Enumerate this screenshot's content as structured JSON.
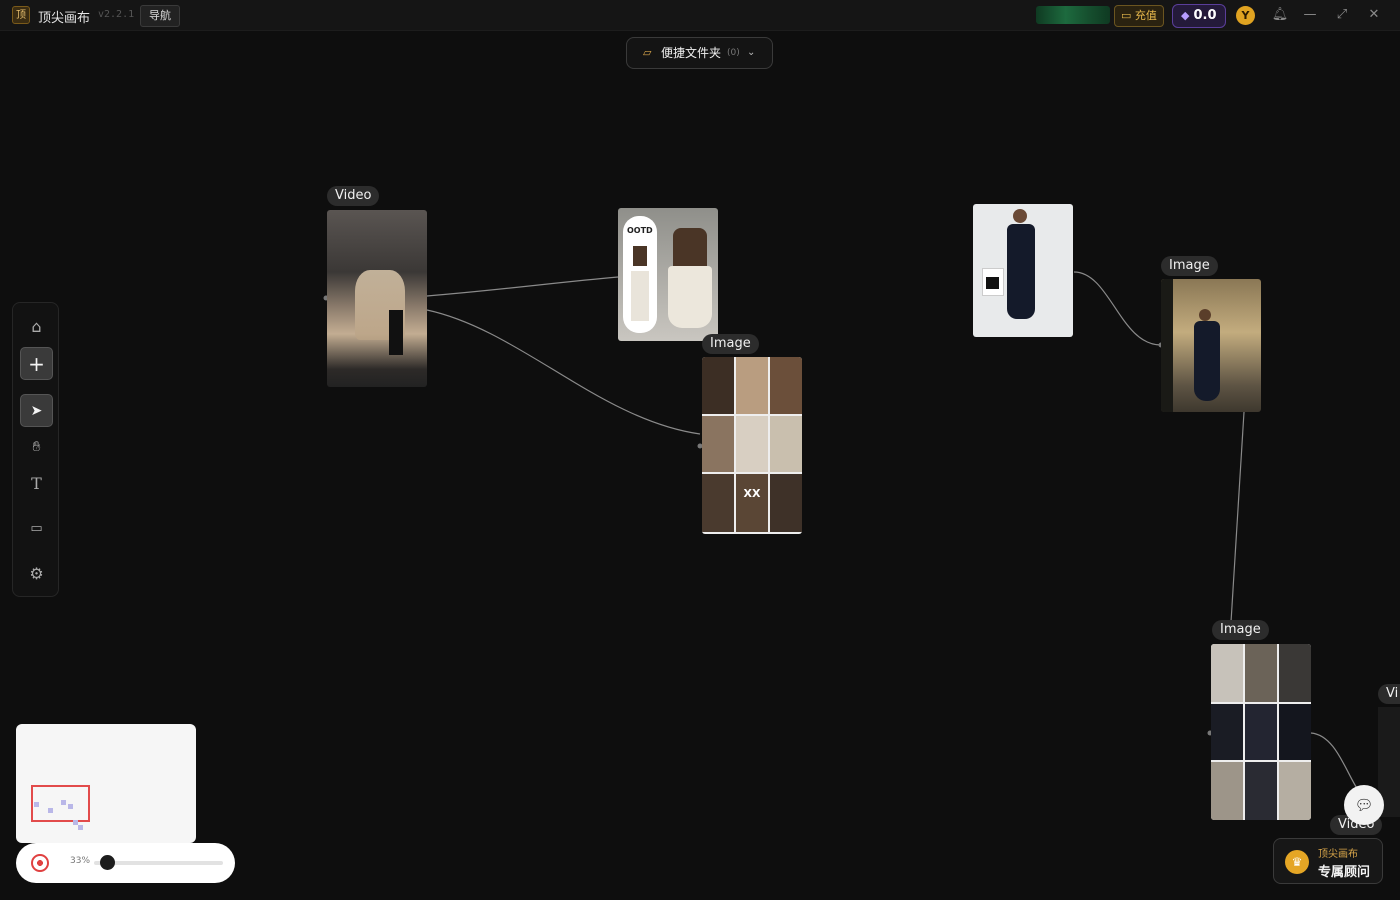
{
  "app": {
    "logo_char": "顶",
    "title": "顶尖画布",
    "version": "v2.2.1",
    "nav_label": "导航"
  },
  "topbar": {
    "recharge_label": "充值",
    "balance": "0.0",
    "avatar_initial": "Y",
    "icons": [
      "bell-icon",
      "minimize-icon",
      "maximize-icon",
      "close-icon"
    ]
  },
  "folder": {
    "label": "便捷文件夹",
    "count": "(0)"
  },
  "toolbar": {
    "tools": [
      "home-icon",
      "plus-icon",
      "cursor-icon",
      "hand-icon",
      "text-icon",
      "folder-icon",
      "settings-icon"
    ],
    "active": "cursor-icon"
  },
  "nodes": {
    "video_1": "Video",
    "image_1": "Image",
    "image_2": "Image",
    "image_3": "Image",
    "partial_right": "Vi",
    "video_2": "Video",
    "ootd_text": "OOTD",
    "collage_badge": "XX"
  },
  "zoom": {
    "value_label": "33%",
    "level": 0.33
  },
  "advisor": {
    "line1": "顶尖画布",
    "line2": "专属顾问"
  },
  "colors": {
    "canvas_bg": "#0e0e0e",
    "accent_gold": "#e5a625",
    "gem_purple": "#5a3e9a",
    "minimap_view": "#e24b4b"
  }
}
